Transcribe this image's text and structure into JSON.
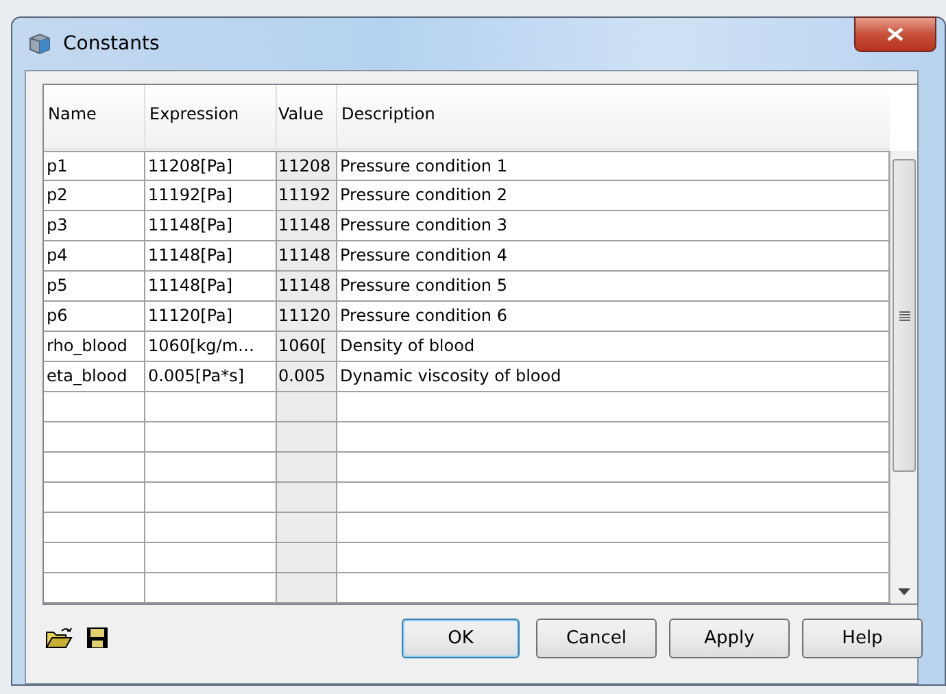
{
  "window": {
    "title": "Constants"
  },
  "table": {
    "columns": [
      "Name",
      "Expression",
      "Value",
      "Description"
    ],
    "rows": [
      {
        "name": "p1",
        "expression": "11208[Pa]",
        "value": "11208",
        "description": "Pressure condition 1"
      },
      {
        "name": "p2",
        "expression": "11192[Pa]",
        "value": "11192",
        "description": "Pressure condition 2"
      },
      {
        "name": "p3",
        "expression": "11148[Pa]",
        "value": "11148",
        "description": "Pressure condition 3"
      },
      {
        "name": "p4",
        "expression": "11148[Pa]",
        "value": "11148",
        "description": "Pressure condition 4"
      },
      {
        "name": "p5",
        "expression": "11148[Pa]",
        "value": "11148",
        "description": "Pressure condition 5"
      },
      {
        "name": "p6",
        "expression": "11120[Pa]",
        "value": "11120",
        "description": "Pressure condition 6"
      },
      {
        "name": "rho_blood",
        "expression": "1060[kg/m…",
        "value": "1060[",
        "description": "Density of blood"
      },
      {
        "name": "eta_blood",
        "expression": "0.005[Pa*s]",
        "value": "0.005",
        "description": "Dynamic viscosity of blood"
      }
    ]
  },
  "buttons": [
    {
      "label": "OK",
      "default": true
    },
    {
      "label": "Cancel",
      "default": false
    },
    {
      "label": "Apply",
      "default": false
    },
    {
      "label": "Help",
      "default": false
    }
  ]
}
